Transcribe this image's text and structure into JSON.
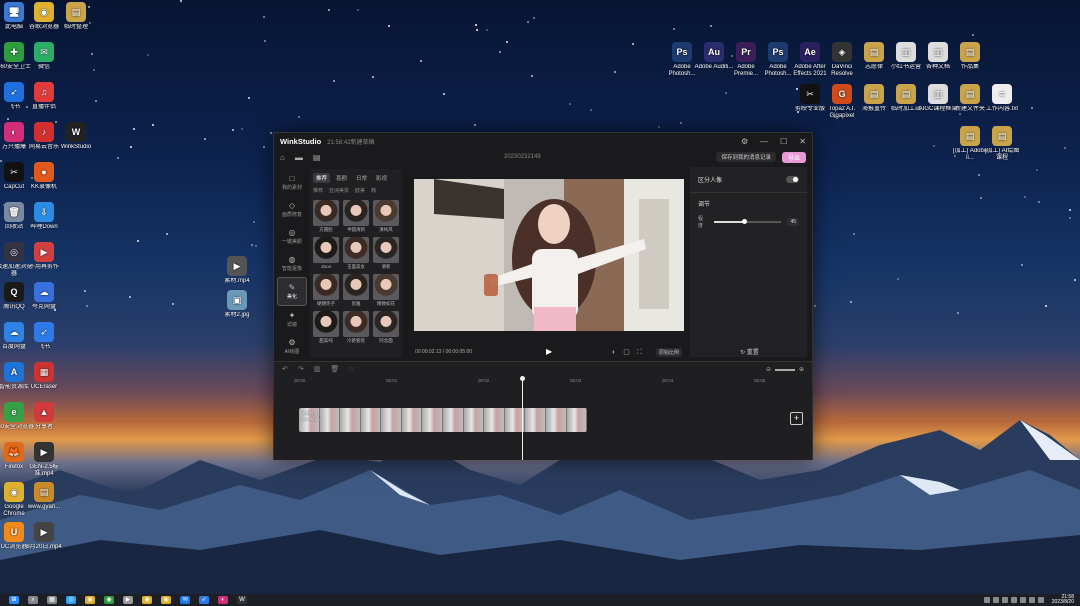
{
  "desktop_icons_left": [
    {
      "label": "此电脑",
      "color": "#3a7bd5",
      "glyph": "🖥"
    },
    {
      "label": "谷歌浏览器",
      "color": "#e0b030",
      "glyph": "◉"
    },
    {
      "label": "临时整理",
      "color": "#c9a44a",
      "glyph": "▤"
    },
    {
      "label": "360安全卫士",
      "color": "#2e9d3d",
      "glyph": "✚"
    },
    {
      "label": "微信",
      "color": "#2aae67",
      "glyph": "✉"
    },
    {
      "label": "飞书",
      "color": "#1f6fe0",
      "glyph": "➶"
    },
    {
      "label": "直播伴侣",
      "color": "#e23b3b",
      "glyph": "♫"
    },
    {
      "label": "万兴播爆",
      "color": "#d12e7a",
      "glyph": "◐"
    },
    {
      "label": "网易云音乐",
      "color": "#d23030",
      "glyph": "♪"
    },
    {
      "label": "WinkStudio",
      "color": "#222",
      "glyph": "W"
    },
    {
      "label": "CapCut",
      "color": "#111",
      "glyph": "✂"
    },
    {
      "label": "KK录像机",
      "color": "#e05a1a",
      "glyph": "●"
    },
    {
      "label": "回收站",
      "color": "#7a8aa0",
      "glyph": "🗑"
    },
    {
      "label": "哔哩Down",
      "color": "#2c8ce3",
      "glyph": "⇩"
    },
    {
      "label": "极速加速浏览器",
      "color": "#334",
      "glyph": "◎"
    },
    {
      "label": "不用再剪作",
      "color": "#d14040",
      "glyph": "▶"
    },
    {
      "label": "腾讯QQ",
      "color": "#1a1a1a",
      "glyph": "Q"
    },
    {
      "label": "夸克网盘",
      "color": "#3a6fe0",
      "glyph": "☁"
    },
    {
      "label": "百度网盘",
      "color": "#2f83e6",
      "glyph": "☁"
    },
    {
      "label": "飞书",
      "color": "#2f7ae6",
      "glyph": "➶"
    },
    {
      "label": "智能资源库",
      "color": "#1e73d6",
      "glyph": "A"
    },
    {
      "label": "UCEraser",
      "color": "#c33",
      "glyph": "▦"
    },
    {
      "label": "360安全浏览器",
      "color": "#36a047",
      "glyph": "e"
    },
    {
      "label": "分享者",
      "color": "#d03a3a",
      "glyph": "▲"
    },
    {
      "label": "Firefox",
      "color": "#e06a1a",
      "glyph": "🦊"
    },
    {
      "label": "GEN-2.5标准.mp4",
      "color": "#333",
      "glyph": "▶"
    },
    {
      "label": "Google Chrome",
      "color": "#e0b030",
      "glyph": "◉"
    },
    {
      "label": "www.gyan...",
      "color": "#c98a2a",
      "glyph": "▤"
    },
    {
      "label": "UC浏览器",
      "color": "#f08a1a",
      "glyph": "U"
    },
    {
      "label": "8月20日.mp4",
      "color": "#444",
      "glyph": "▶"
    }
  ],
  "desktop_icons_mid": [
    {
      "label": "素材.mp4",
      "color": "#555",
      "glyph": "▶"
    },
    {
      "label": "素材2.jpg",
      "color": "#6a9ab8",
      "glyph": "▣"
    }
  ],
  "desktop_icons_right_row1": [
    {
      "label": "Adobe Photosh...",
      "color": "#1d3b6e",
      "glyph": "Ps"
    },
    {
      "label": "Adobe Auditi...",
      "color": "#2a2e6e",
      "glyph": "Au"
    },
    {
      "label": "Adobe Premie...",
      "color": "#3b1e5a",
      "glyph": "Pr"
    },
    {
      "label": "Adobe Photosh...",
      "color": "#1d3b6e",
      "glyph": "Ps"
    },
    {
      "label": "Adobe After Effects 2021",
      "color": "#2a2060",
      "glyph": "Ae"
    },
    {
      "label": "DaVinci Resolve",
      "color": "#333",
      "glyph": "◈"
    },
    {
      "label": "志愿律",
      "color": "#c9a44a",
      "glyph": "▤"
    },
    {
      "label": "小红书运营",
      "color": "#ddd",
      "glyph": "▥"
    },
    {
      "label": "各种文档",
      "color": "#ddd",
      "glyph": "▥"
    },
    {
      "label": "作品集",
      "color": "#c9a44a",
      "glyph": "▤"
    }
  ],
  "desktop_icons_right_row2": [
    {
      "label": "剪映专业版",
      "color": "#111",
      "glyph": "✂"
    },
    {
      "label": "Topaz A.I. Gigapixel",
      "color": "#d04a1a",
      "glyph": "G"
    },
    {
      "label": "海报重传",
      "color": "#c9a44a",
      "glyph": "▤"
    },
    {
      "label": "临时加工站",
      "color": "#c9a44a",
      "glyph": "▤"
    },
    {
      "label": "AIGC课程框架",
      "color": "#ddd",
      "glyph": "▥"
    },
    {
      "label": "新建文件夹",
      "color": "#c9a44a",
      "glyph": "▤"
    },
    {
      "label": "工作内容.txt",
      "color": "#eee",
      "glyph": "≡"
    }
  ],
  "desktop_icons_right_row3": [
    {
      "label": "[加工] Adobe li...",
      "color": "#c9a44a",
      "glyph": "▤"
    },
    {
      "label": "[加工] AI绘图课程",
      "color": "#c9a44a",
      "glyph": "▤"
    }
  ],
  "app": {
    "brand": "WinkStudio",
    "subtitle": "21:58:42新建草稿",
    "project_name": "20230232149",
    "save_label": "保存到我的消息记录",
    "export_label": "导出",
    "nav": [
      {
        "label": "我的素材",
        "icon": "□"
      },
      {
        "label": "画质修复",
        "icon": "◇"
      },
      {
        "label": "一键美颜",
        "icon": "◎"
      },
      {
        "label": "智能抠像",
        "icon": "◍"
      },
      {
        "label": "美化",
        "icon": "✎",
        "active": true
      },
      {
        "label": "滤镜",
        "icon": "✦"
      },
      {
        "label": "AI绘图",
        "icon": "⚙"
      }
    ],
    "tabs": [
      "推荐",
      "喜剧",
      "日常",
      "影视"
    ],
    "active_tab": "推荐",
    "subtabs": [
      "推荐",
      "亚洲美妆",
      "欧美",
      "韩"
    ],
    "presets": [
      "方圆脸",
      "半圆清新",
      "清纯风",
      "Jisoo",
      "玉面美女",
      "清新",
      "硬朗笑子",
      "优雅",
      "精致如花",
      "甜美纯",
      "冷艳套装",
      "阿念面"
    ],
    "time_current": "00:00:02:13",
    "time_total": "00:00:05:00",
    "ratio_label": "原始比例",
    "right_panel": {
      "toggle_label": "区分人像",
      "section_title": "调节",
      "slider_label": "程度",
      "slider_value": "45",
      "slider_fraction": 0.45,
      "reset_label": "重置"
    },
    "ruler_ticks": [
      "00:00",
      "00:01",
      "00:02",
      "00:03",
      "00:04",
      "00:05"
    ],
    "track_label_1": "素材.mp4",
    "track_label_2": "00:05:00",
    "add_label": "+"
  },
  "taskbar": {
    "apps": [
      "⊞",
      "⌕",
      "▦",
      "◎",
      "◉",
      "◉",
      "▶",
      "◉",
      "◉",
      "✉",
      "➶",
      "◐",
      "W"
    ],
    "app_colors": [
      "#2e8bff",
      "#888",
      "#888",
      "#29a3ff",
      "#e0b030",
      "#2e9d3d",
      "#999",
      "#e0b030",
      "#e0b030",
      "#1f7ae6",
      "#2f7ae6",
      "#d12e7a",
      "#333"
    ],
    "time": "21:58",
    "date": "2023/8/20"
  }
}
